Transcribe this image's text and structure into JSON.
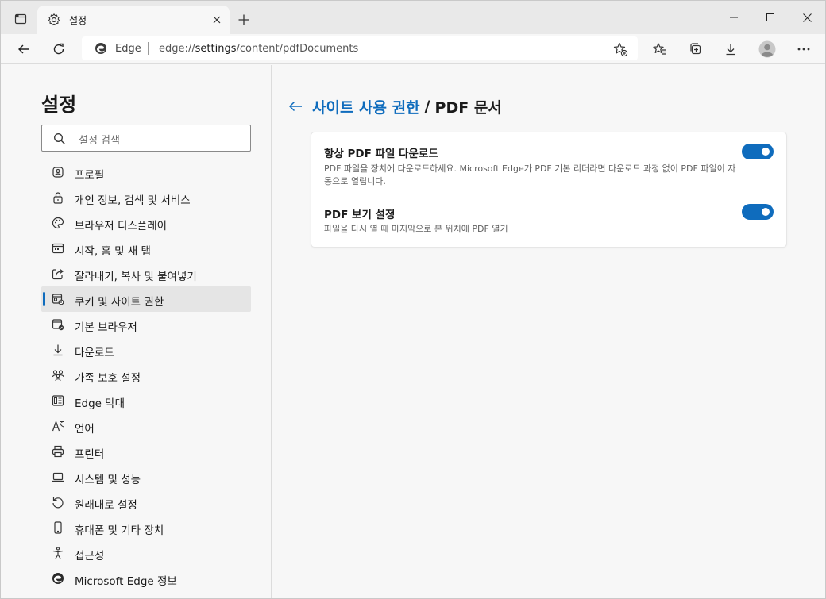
{
  "browser": {
    "tab_title": "설정",
    "address": {
      "site_label": "Edge",
      "url_scheme": "edge://",
      "url_host": "settings",
      "url_path": "/content/pdfDocuments"
    }
  },
  "sidebar": {
    "heading": "설정",
    "search_placeholder": "설정 검색",
    "items": [
      {
        "label": "프로필",
        "icon": "profile-icon",
        "active": false
      },
      {
        "label": "개인 정보, 검색 및 서비스",
        "icon": "lock-icon",
        "active": false
      },
      {
        "label": "브라우저 디스플레이",
        "icon": "palette-icon",
        "active": false
      },
      {
        "label": "시작, 홈 및 새 탭",
        "icon": "home-window-icon",
        "active": false
      },
      {
        "label": "잘라내기, 복사 및 붙여넣기",
        "icon": "share-icon",
        "active": false
      },
      {
        "label": "쿠키 및 사이트 권한",
        "icon": "site-permissions-icon",
        "active": true
      },
      {
        "label": "기본 브라우저",
        "icon": "default-browser-icon",
        "active": false
      },
      {
        "label": "다운로드",
        "icon": "download-icon",
        "active": false
      },
      {
        "label": "가족 보호 설정",
        "icon": "family-icon",
        "active": false
      },
      {
        "label": "Edge 막대",
        "icon": "edge-bar-icon",
        "active": false
      },
      {
        "label": "언어",
        "icon": "language-icon",
        "active": false
      },
      {
        "label": "프린터",
        "icon": "printer-icon",
        "active": false
      },
      {
        "label": "시스템 및 성능",
        "icon": "laptop-icon",
        "active": false
      },
      {
        "label": "원래대로 설정",
        "icon": "reset-icon",
        "active": false
      },
      {
        "label": "휴대폰 및 기타 장치",
        "icon": "phone-icon",
        "active": false
      },
      {
        "label": "접근성",
        "icon": "accessibility-icon",
        "active": false
      },
      {
        "label": "Microsoft Edge 정보",
        "icon": "edge-logo-icon",
        "active": false
      }
    ]
  },
  "main": {
    "breadcrumb_parent": "사이트 사용 권한",
    "breadcrumb_separator": "/",
    "breadcrumb_current": "PDF 문서",
    "settings": [
      {
        "title": "항상 PDF 파일 다운로드",
        "description": "PDF 파일을 장치에 다운로드하세요. Microsoft Edge가 PDF 기본 리더라면 다운로드 과정 없이 PDF 파일이 자동으로 열립니다.",
        "enabled": true
      },
      {
        "title": "PDF 보기 설정",
        "description": "파일을 다시 열 때 마지막으로 본 위치에 PDF 열기",
        "enabled": true
      }
    ]
  },
  "colors": {
    "accent": "#0f6cbd",
    "sidebar_active_bg": "#e5e5e5",
    "page_bg": "#f7f7f7"
  }
}
